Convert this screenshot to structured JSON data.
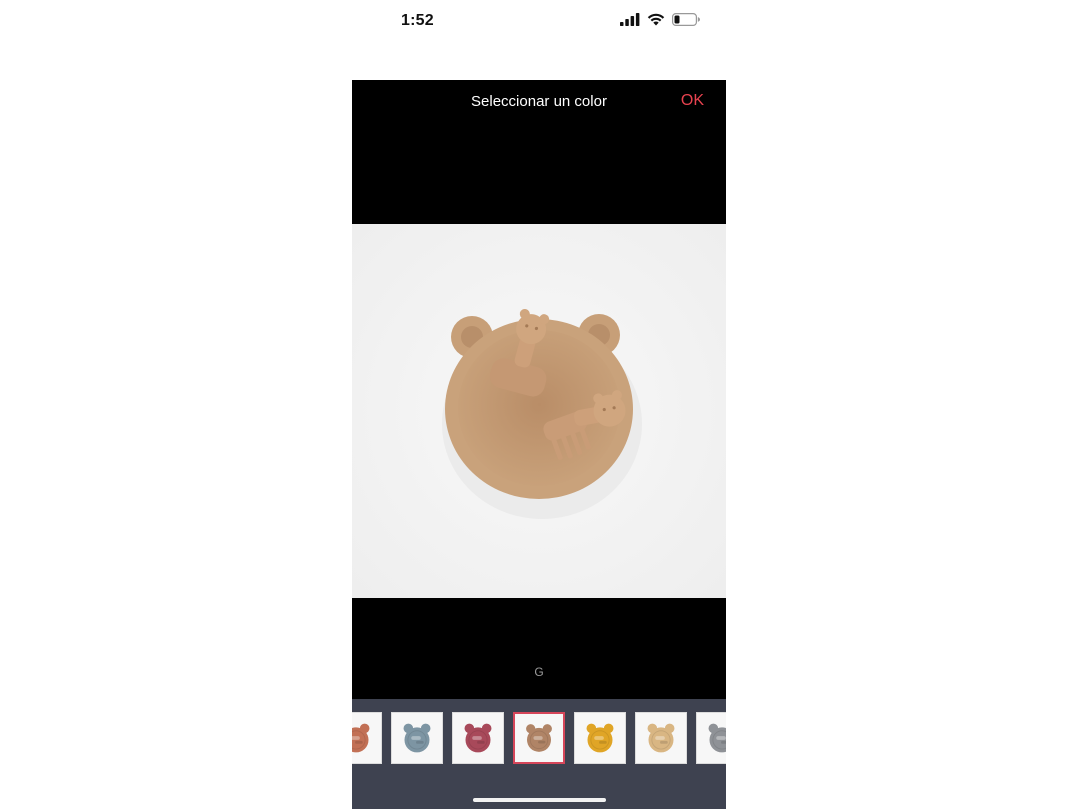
{
  "status_bar": {
    "time": "1:52",
    "icons": [
      "signal-icon",
      "wifi-icon",
      "battery-icon"
    ]
  },
  "header": {
    "title": "Seleccionar un color",
    "ok_label": "OK"
  },
  "product_image": {
    "description_icon": "bear-bowl-with-spoon-and-fork",
    "color": "#c79f78"
  },
  "selected_variant_label": "G",
  "thumbnails": [
    {
      "name": "terracotta",
      "color": "#c27055",
      "selected": false
    },
    {
      "name": "blue-grey",
      "color": "#7d95a3",
      "selected": false
    },
    {
      "name": "rose",
      "color": "#a8495a",
      "selected": false
    },
    {
      "name": "tan",
      "color": "#b08466",
      "selected": true
    },
    {
      "name": "mustard",
      "color": "#e0a526",
      "selected": false
    },
    {
      "name": "beige",
      "color": "#d9b683",
      "selected": false
    },
    {
      "name": "grey",
      "color": "#8f9297",
      "selected": false
    }
  ],
  "colors": {
    "accent": "#e8424f",
    "selected_border": "#d6465a",
    "thumb_bar_bg": "#3e4250"
  }
}
